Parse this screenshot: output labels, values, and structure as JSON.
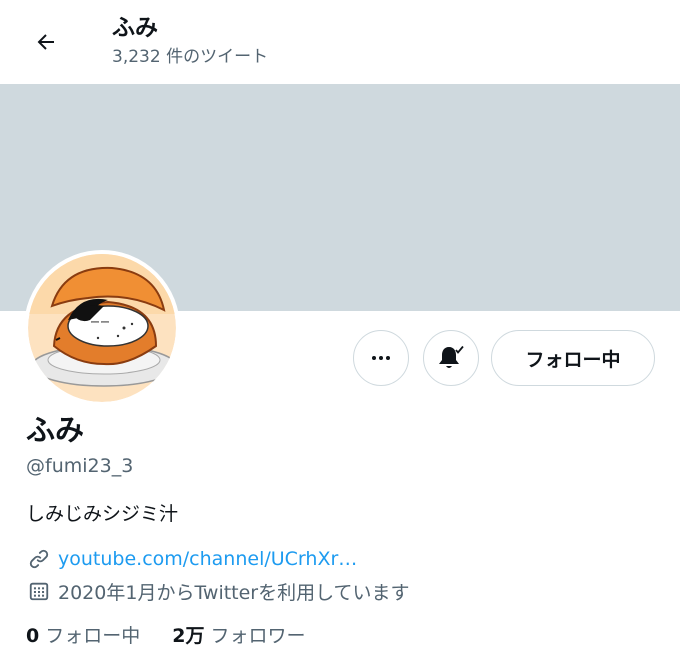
{
  "header": {
    "name": "ふみ",
    "tweet_count": "3,232 件のツイート"
  },
  "profile": {
    "display_name": "ふみ",
    "handle": "@fumi23_3",
    "bio": "しみじみシジミ汁",
    "link_text": "youtube.com/channel/UCrhXr…",
    "joined": "2020年1月からTwitterを利用しています"
  },
  "actions": {
    "follow_label": "フォロー中"
  },
  "stats": {
    "following_count": "0",
    "following_label": "フォロー中",
    "followers_count": "2万",
    "followers_label": "フォロワー"
  },
  "icons": {
    "back": "back-arrow-icon",
    "more": "more-dots-icon",
    "bell": "bell-check-icon",
    "link": "link-icon",
    "calendar": "calendar-icon"
  },
  "colors": {
    "banner": "#cfd9de",
    "link": "#1d9bf0",
    "secondary_text": "#536471",
    "primary_text": "#0f1419"
  }
}
